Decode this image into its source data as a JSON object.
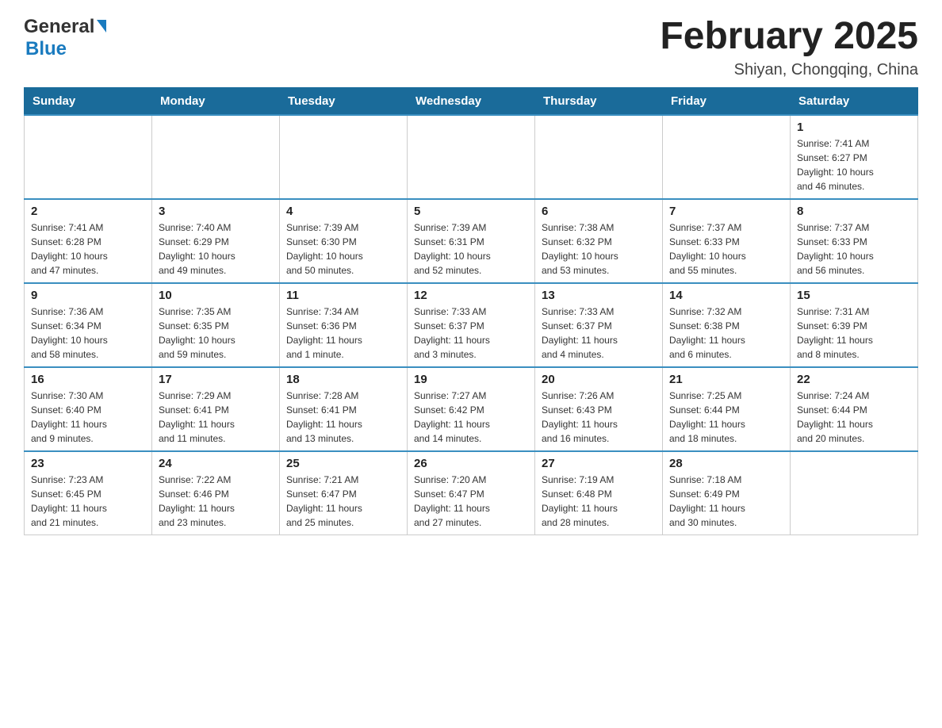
{
  "header": {
    "logo_general": "General",
    "logo_blue": "Blue",
    "month_title": "February 2025",
    "location": "Shiyan, Chongqing, China"
  },
  "weekdays": [
    "Sunday",
    "Monday",
    "Tuesday",
    "Wednesday",
    "Thursday",
    "Friday",
    "Saturday"
  ],
  "weeks": [
    {
      "days": [
        {
          "number": "",
          "info": ""
        },
        {
          "number": "",
          "info": ""
        },
        {
          "number": "",
          "info": ""
        },
        {
          "number": "",
          "info": ""
        },
        {
          "number": "",
          "info": ""
        },
        {
          "number": "",
          "info": ""
        },
        {
          "number": "1",
          "info": "Sunrise: 7:41 AM\nSunset: 6:27 PM\nDaylight: 10 hours\nand 46 minutes."
        }
      ]
    },
    {
      "days": [
        {
          "number": "2",
          "info": "Sunrise: 7:41 AM\nSunset: 6:28 PM\nDaylight: 10 hours\nand 47 minutes."
        },
        {
          "number": "3",
          "info": "Sunrise: 7:40 AM\nSunset: 6:29 PM\nDaylight: 10 hours\nand 49 minutes."
        },
        {
          "number": "4",
          "info": "Sunrise: 7:39 AM\nSunset: 6:30 PM\nDaylight: 10 hours\nand 50 minutes."
        },
        {
          "number": "5",
          "info": "Sunrise: 7:39 AM\nSunset: 6:31 PM\nDaylight: 10 hours\nand 52 minutes."
        },
        {
          "number": "6",
          "info": "Sunrise: 7:38 AM\nSunset: 6:32 PM\nDaylight: 10 hours\nand 53 minutes."
        },
        {
          "number": "7",
          "info": "Sunrise: 7:37 AM\nSunset: 6:33 PM\nDaylight: 10 hours\nand 55 minutes."
        },
        {
          "number": "8",
          "info": "Sunrise: 7:37 AM\nSunset: 6:33 PM\nDaylight: 10 hours\nand 56 minutes."
        }
      ]
    },
    {
      "days": [
        {
          "number": "9",
          "info": "Sunrise: 7:36 AM\nSunset: 6:34 PM\nDaylight: 10 hours\nand 58 minutes."
        },
        {
          "number": "10",
          "info": "Sunrise: 7:35 AM\nSunset: 6:35 PM\nDaylight: 10 hours\nand 59 minutes."
        },
        {
          "number": "11",
          "info": "Sunrise: 7:34 AM\nSunset: 6:36 PM\nDaylight: 11 hours\nand 1 minute."
        },
        {
          "number": "12",
          "info": "Sunrise: 7:33 AM\nSunset: 6:37 PM\nDaylight: 11 hours\nand 3 minutes."
        },
        {
          "number": "13",
          "info": "Sunrise: 7:33 AM\nSunset: 6:37 PM\nDaylight: 11 hours\nand 4 minutes."
        },
        {
          "number": "14",
          "info": "Sunrise: 7:32 AM\nSunset: 6:38 PM\nDaylight: 11 hours\nand 6 minutes."
        },
        {
          "number": "15",
          "info": "Sunrise: 7:31 AM\nSunset: 6:39 PM\nDaylight: 11 hours\nand 8 minutes."
        }
      ]
    },
    {
      "days": [
        {
          "number": "16",
          "info": "Sunrise: 7:30 AM\nSunset: 6:40 PM\nDaylight: 11 hours\nand 9 minutes."
        },
        {
          "number": "17",
          "info": "Sunrise: 7:29 AM\nSunset: 6:41 PM\nDaylight: 11 hours\nand 11 minutes."
        },
        {
          "number": "18",
          "info": "Sunrise: 7:28 AM\nSunset: 6:41 PM\nDaylight: 11 hours\nand 13 minutes."
        },
        {
          "number": "19",
          "info": "Sunrise: 7:27 AM\nSunset: 6:42 PM\nDaylight: 11 hours\nand 14 minutes."
        },
        {
          "number": "20",
          "info": "Sunrise: 7:26 AM\nSunset: 6:43 PM\nDaylight: 11 hours\nand 16 minutes."
        },
        {
          "number": "21",
          "info": "Sunrise: 7:25 AM\nSunset: 6:44 PM\nDaylight: 11 hours\nand 18 minutes."
        },
        {
          "number": "22",
          "info": "Sunrise: 7:24 AM\nSunset: 6:44 PM\nDaylight: 11 hours\nand 20 minutes."
        }
      ]
    },
    {
      "days": [
        {
          "number": "23",
          "info": "Sunrise: 7:23 AM\nSunset: 6:45 PM\nDaylight: 11 hours\nand 21 minutes."
        },
        {
          "number": "24",
          "info": "Sunrise: 7:22 AM\nSunset: 6:46 PM\nDaylight: 11 hours\nand 23 minutes."
        },
        {
          "number": "25",
          "info": "Sunrise: 7:21 AM\nSunset: 6:47 PM\nDaylight: 11 hours\nand 25 minutes."
        },
        {
          "number": "26",
          "info": "Sunrise: 7:20 AM\nSunset: 6:47 PM\nDaylight: 11 hours\nand 27 minutes."
        },
        {
          "number": "27",
          "info": "Sunrise: 7:19 AM\nSunset: 6:48 PM\nDaylight: 11 hours\nand 28 minutes."
        },
        {
          "number": "28",
          "info": "Sunrise: 7:18 AM\nSunset: 6:49 PM\nDaylight: 11 hours\nand 30 minutes."
        },
        {
          "number": "",
          "info": ""
        }
      ]
    }
  ]
}
